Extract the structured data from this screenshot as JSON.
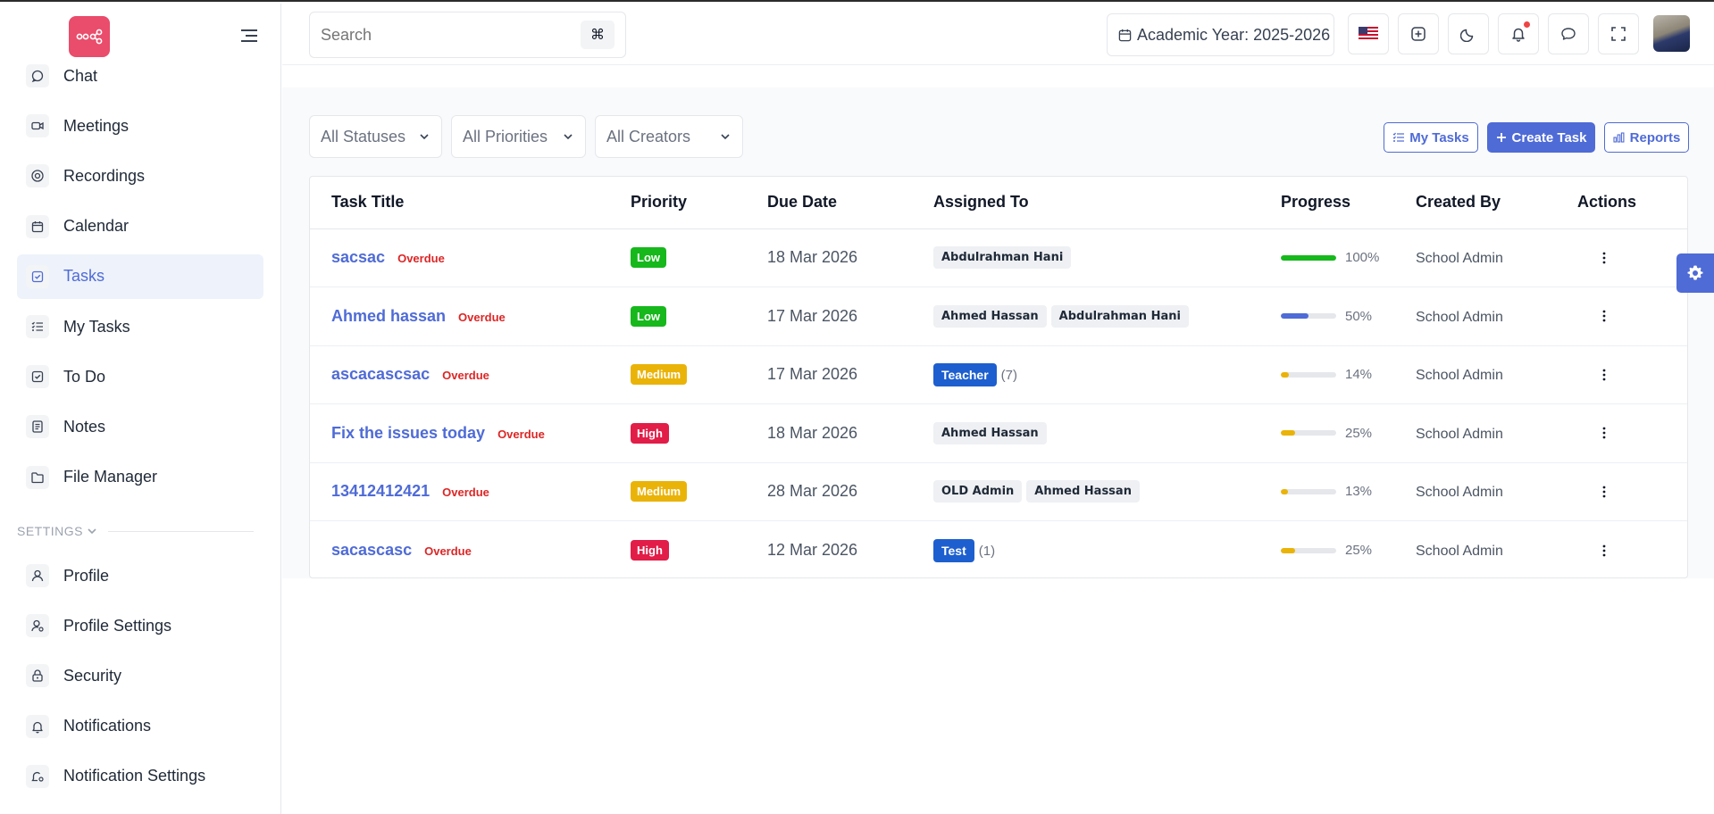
{
  "sidebar": {
    "items": [
      {
        "label": "Chat",
        "icon": "chat-icon"
      },
      {
        "label": "Meetings",
        "icon": "video-icon"
      },
      {
        "label": "Recordings",
        "icon": "recording-icon"
      },
      {
        "label": "Calendar",
        "icon": "calendar-icon"
      },
      {
        "label": "Tasks",
        "icon": "task-check-icon",
        "active": true
      },
      {
        "label": "My Tasks",
        "icon": "list-check-icon"
      },
      {
        "label": "To Do",
        "icon": "checkbox-icon"
      },
      {
        "label": "Notes",
        "icon": "note-icon"
      },
      {
        "label": "File Manager",
        "icon": "folder-icon"
      }
    ],
    "settings_title": "SETTINGS",
    "settings_items": [
      {
        "label": "Profile",
        "icon": "user-icon"
      },
      {
        "label": "Profile Settings",
        "icon": "user-gear-icon"
      },
      {
        "label": "Security",
        "icon": "lock-icon"
      },
      {
        "label": "Notifications",
        "icon": "bell-icon"
      },
      {
        "label": "Notification Settings",
        "icon": "bell-gear-icon"
      }
    ]
  },
  "header": {
    "search_placeholder": "Search",
    "search_shortcut": "⌘",
    "academic_year": "Academic Year: 2025-2026"
  },
  "filters": {
    "status": "All Statuses",
    "priority": "All Priorities",
    "creator": "All Creators"
  },
  "actions": {
    "my_tasks": "My Tasks",
    "create_task": "Create Task",
    "reports": "Reports"
  },
  "table": {
    "headers": {
      "title": "Task Title",
      "priority": "Priority",
      "due": "Due Date",
      "assigned": "Assigned To",
      "progress": "Progress",
      "created": "Created By",
      "actions": "Actions"
    },
    "rows": [
      {
        "title": "sacsac",
        "status": "Overdue",
        "priority": "Low",
        "due": "18 Mar 2026",
        "assignees": [
          "Abdulrahman Hani"
        ],
        "progress": 100,
        "progress_label": "100%",
        "created_by": "School Admin"
      },
      {
        "title": "Ahmed hassan",
        "status": "Overdue",
        "priority": "Low",
        "due": "17 Mar 2026",
        "assignees": [
          "Ahmed Hassan",
          "Abdulrahman Hani"
        ],
        "progress": 50,
        "progress_label": "50%",
        "created_by": "School Admin"
      },
      {
        "title": "ascacascsac",
        "status": "Overdue",
        "priority": "Medium",
        "due": "17 Mar 2026",
        "group": "Teacher",
        "group_count": "(7)",
        "progress": 14,
        "progress_label": "14%",
        "created_by": "School Admin"
      },
      {
        "title": "Fix the issues today",
        "status": "Overdue",
        "priority": "High",
        "due": "18 Mar 2026",
        "assignees": [
          "Ahmed Hassan"
        ],
        "progress": 25,
        "progress_label": "25%",
        "created_by": "School Admin"
      },
      {
        "title": "13412412421",
        "status": "Overdue",
        "priority": "Medium",
        "due": "28 Mar 2026",
        "assignees": [
          "OLD Admin",
          "Ahmed Hassan"
        ],
        "progress": 13,
        "progress_label": "13%",
        "created_by": "School Admin"
      },
      {
        "title": "sacascasc",
        "status": "Overdue",
        "priority": "High",
        "due": "12 Mar 2026",
        "group": "Test",
        "group_count": "(1)",
        "progress": 25,
        "progress_label": "25%",
        "created_by": "School Admin"
      }
    ]
  },
  "colors": {
    "accent": "#4f6bd6",
    "low": "#16b81c",
    "medium": "#eab308",
    "high": "#e11d48",
    "overdue": "#dc2626",
    "logo": "#ea4c6b"
  }
}
